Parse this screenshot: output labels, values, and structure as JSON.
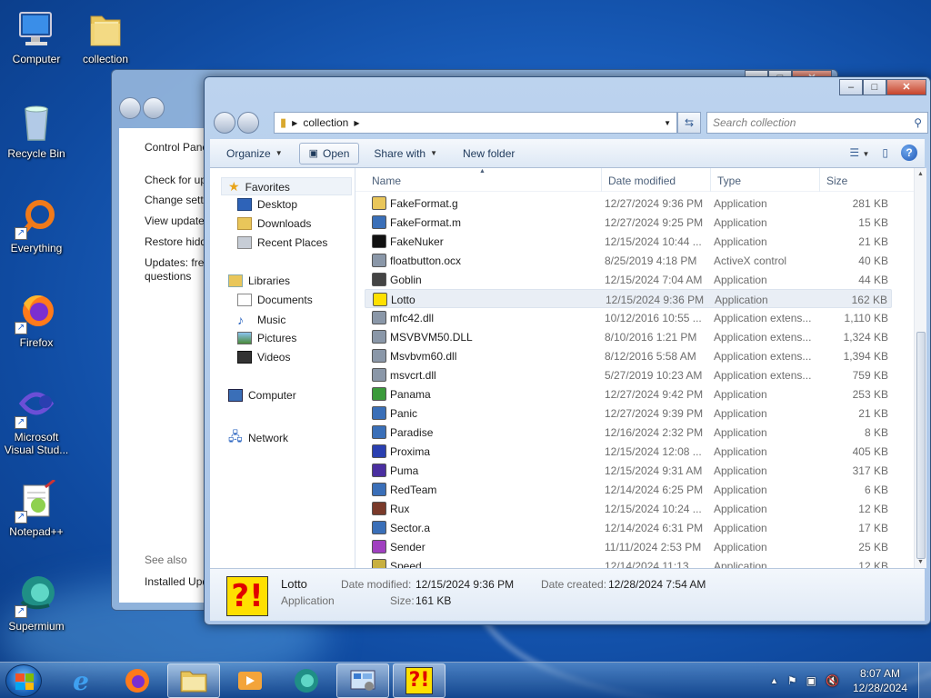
{
  "desktop": {
    "icons": [
      {
        "label": "Computer"
      },
      {
        "label": "collection"
      },
      {
        "label": "Recycle Bin"
      },
      {
        "label": "Everything"
      },
      {
        "label": "Firefox"
      },
      {
        "label": "Microsoft Visual Stud..."
      },
      {
        "label": "Notepad++"
      },
      {
        "label": "Supermium"
      }
    ]
  },
  "back_window": {
    "links": [
      "Control Panel",
      "Check for up",
      "Change setti",
      "View update",
      "Restore hidd",
      "Updates: free",
      "questions",
      "See also",
      "Installed Upd"
    ]
  },
  "explorer": {
    "title": "collection",
    "address": {
      "path": [
        "collection"
      ]
    },
    "search": {
      "placeholder": "Search collection"
    },
    "toolbar": {
      "organize": "Organize",
      "open": "Open",
      "share_with": "Share with",
      "new_folder": "New folder"
    },
    "nav": {
      "favorites": "Favorites",
      "desktop": "Desktop",
      "downloads": "Downloads",
      "recent": "Recent Places",
      "libraries": "Libraries",
      "documents": "Documents",
      "music": "Music",
      "pictures": "Pictures",
      "videos": "Videos",
      "computer": "Computer",
      "network": "Network"
    },
    "columns": {
      "name": "Name",
      "date": "Date modified",
      "type": "Type",
      "size": "Size"
    },
    "files": [
      {
        "name": "FakeFormat.g",
        "date": "12/27/2024 9:36 PM",
        "type": "Application",
        "size": "281 KB",
        "icon": "folder-app-icon"
      },
      {
        "name": "FakeFormat.m",
        "date": "12/27/2024 9:25 PM",
        "type": "Application",
        "size": "15 KB",
        "icon": "window-app-icon"
      },
      {
        "name": "FakeNuker",
        "date": "12/15/2024 10:44 ...",
        "type": "Application",
        "size": "21 KB",
        "icon": "play-app-icon"
      },
      {
        "name": "floatbutton.ocx",
        "date": "8/25/2019 4:18 PM",
        "type": "ActiveX control",
        "size": "40 KB",
        "icon": "gear-file-icon"
      },
      {
        "name": "Goblin",
        "date": "12/15/2024 7:04 AM",
        "type": "Application",
        "size": "44 KB",
        "icon": "goblin-app-icon"
      },
      {
        "name": "Lotto",
        "date": "12/15/2024 9:36 PM",
        "type": "Application",
        "size": "162 KB",
        "icon": "lotto-app-icon"
      },
      {
        "name": "mfc42.dll",
        "date": "10/12/2016 10:55 ...",
        "type": "Application extens...",
        "size": "1,110 KB",
        "icon": "gear-file-icon"
      },
      {
        "name": "MSVBVM50.DLL",
        "date": "8/10/2016 1:21 PM",
        "type": "Application extens...",
        "size": "1,324 KB",
        "icon": "gear-file-icon"
      },
      {
        "name": "Msvbvm60.dll",
        "date": "8/12/2016 5:58 AM",
        "type": "Application extens...",
        "size": "1,394 KB",
        "icon": "gear-file-icon"
      },
      {
        "name": "msvcrt.dll",
        "date": "5/27/2019 10:23 AM",
        "type": "Application extens...",
        "size": "759 KB",
        "icon": "gear-file-icon"
      },
      {
        "name": "Panama",
        "date": "12/27/2024 9:42 PM",
        "type": "Application",
        "size": "253 KB",
        "icon": "panama-app-icon"
      },
      {
        "name": "Panic",
        "date": "12/27/2024 9:39 PM",
        "type": "Application",
        "size": "21 KB",
        "icon": "window-app-icon"
      },
      {
        "name": "Paradise",
        "date": "12/16/2024 2:32 PM",
        "type": "Application",
        "size": "8 KB",
        "icon": "window-app-icon"
      },
      {
        "name": "Proxima",
        "date": "12/15/2024 12:08 ...",
        "type": "Application",
        "size": "405 KB",
        "icon": "proxima-app-icon"
      },
      {
        "name": "Puma",
        "date": "12/15/2024 9:31 AM",
        "type": "Application",
        "size": "317 KB",
        "icon": "puma-app-icon"
      },
      {
        "name": "RedTeam",
        "date": "12/14/2024 6:25 PM",
        "type": "Application",
        "size": "6 KB",
        "icon": "window-app-icon"
      },
      {
        "name": "Rux",
        "date": "12/15/2024 10:24 ...",
        "type": "Application",
        "size": "12 KB",
        "icon": "rux-app-icon"
      },
      {
        "name": "Sector.a",
        "date": "12/14/2024 6:31 PM",
        "type": "Application",
        "size": "17 KB",
        "icon": "window-app-icon"
      },
      {
        "name": "Sender",
        "date": "11/11/2024 2:53 PM",
        "type": "Application",
        "size": "25 KB",
        "icon": "sender-app-icon"
      },
      {
        "name": "Speed",
        "date": "12/14/2024 11:13 ...",
        "type": "Application",
        "size": "12 KB",
        "icon": "speed-app-icon"
      }
    ],
    "selected_index": 5,
    "details": {
      "icon_text": "?!",
      "name": "Lotto",
      "type": "Application",
      "date_modified_label": "Date modified:",
      "date_modified": "12/15/2024 9:36 PM",
      "size_label": "Size:",
      "size": "161 KB",
      "date_created_label": "Date created:",
      "date_created": "12/28/2024 7:54 AM"
    }
  },
  "taskbar": {
    "lotto_text": "?!",
    "time": "8:07 AM",
    "date": "12/28/2024"
  }
}
